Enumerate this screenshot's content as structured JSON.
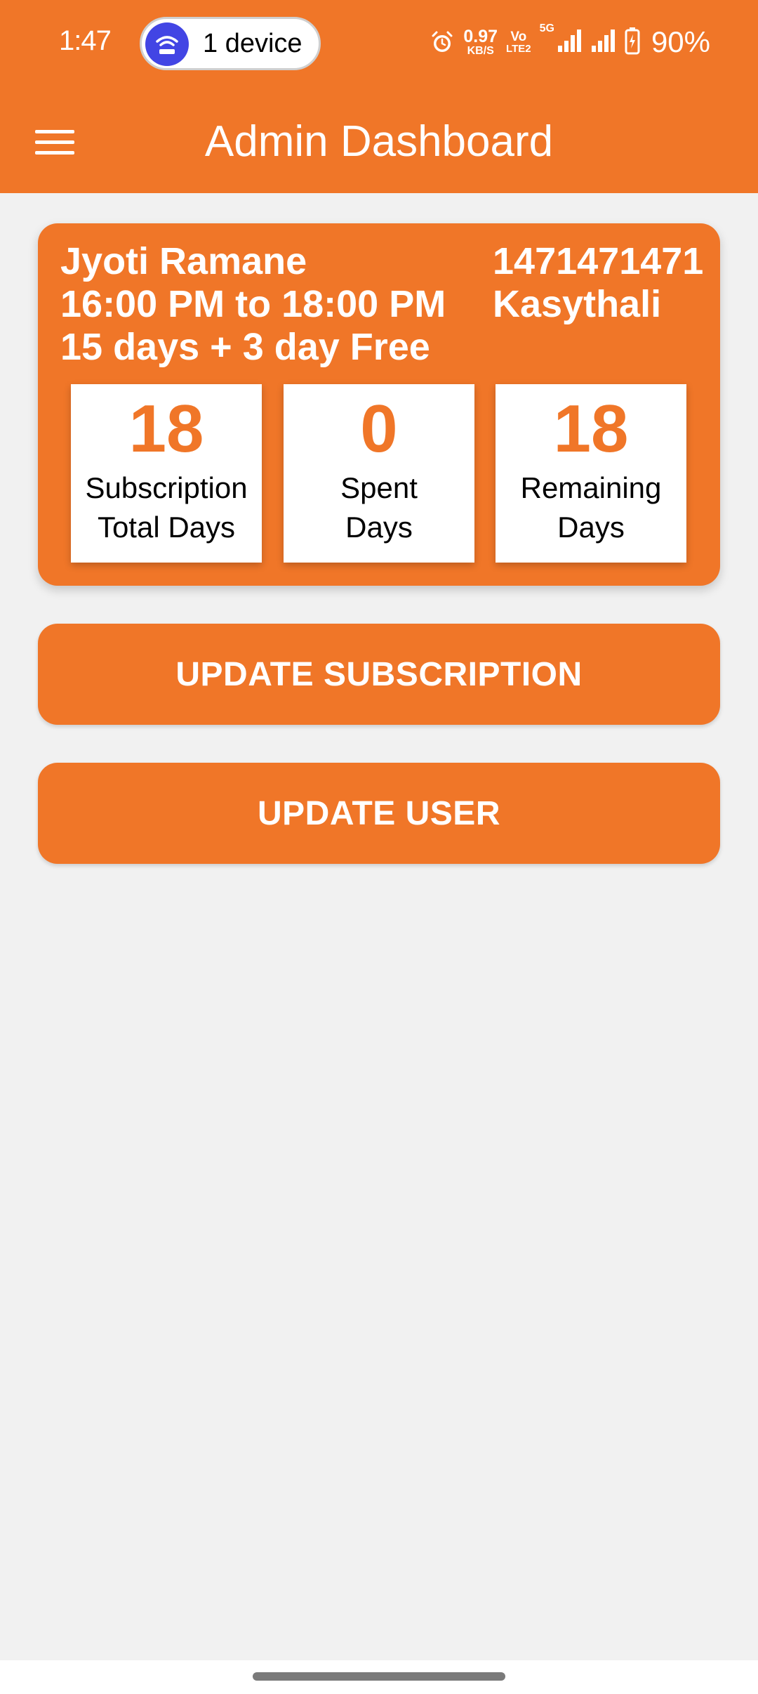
{
  "status_bar": {
    "time": "1:47",
    "hotspot_label": "1 device",
    "speed_value": "0.97",
    "speed_unit": "KB/S",
    "volte_top": "Vo",
    "volte_bottom": "LTE2",
    "network_5g": "5G",
    "battery_pct": "90%"
  },
  "app_bar": {
    "title": "Admin Dashboard"
  },
  "card": {
    "name": "Jyoti Ramane",
    "time_slot": "16:00 PM to 18:00 PM",
    "plan": "15 days + 3 day Free",
    "phone": "1471471471",
    "location": "Kasythali",
    "stats": [
      {
        "value": "18",
        "label_line1": "Subscription",
        "label_line2": "Total Days"
      },
      {
        "value": "0",
        "label_line1": "Spent",
        "label_line2": "Days"
      },
      {
        "value": "18",
        "label_line1": "Remaining",
        "label_line2": "Days"
      }
    ]
  },
  "buttons": {
    "update_subscription": "UPDATE SUBSCRIPTION",
    "update_user": "UPDATE USER"
  },
  "colors": {
    "accent": "#f07628",
    "background": "#f1f1f1",
    "hotspot": "#4245e4"
  },
  "icons": {
    "menu": "menu-icon",
    "hotspot": "hotspot-icon",
    "alarm": "alarm-icon",
    "signal": "signal-icon",
    "battery": "battery-icon"
  }
}
